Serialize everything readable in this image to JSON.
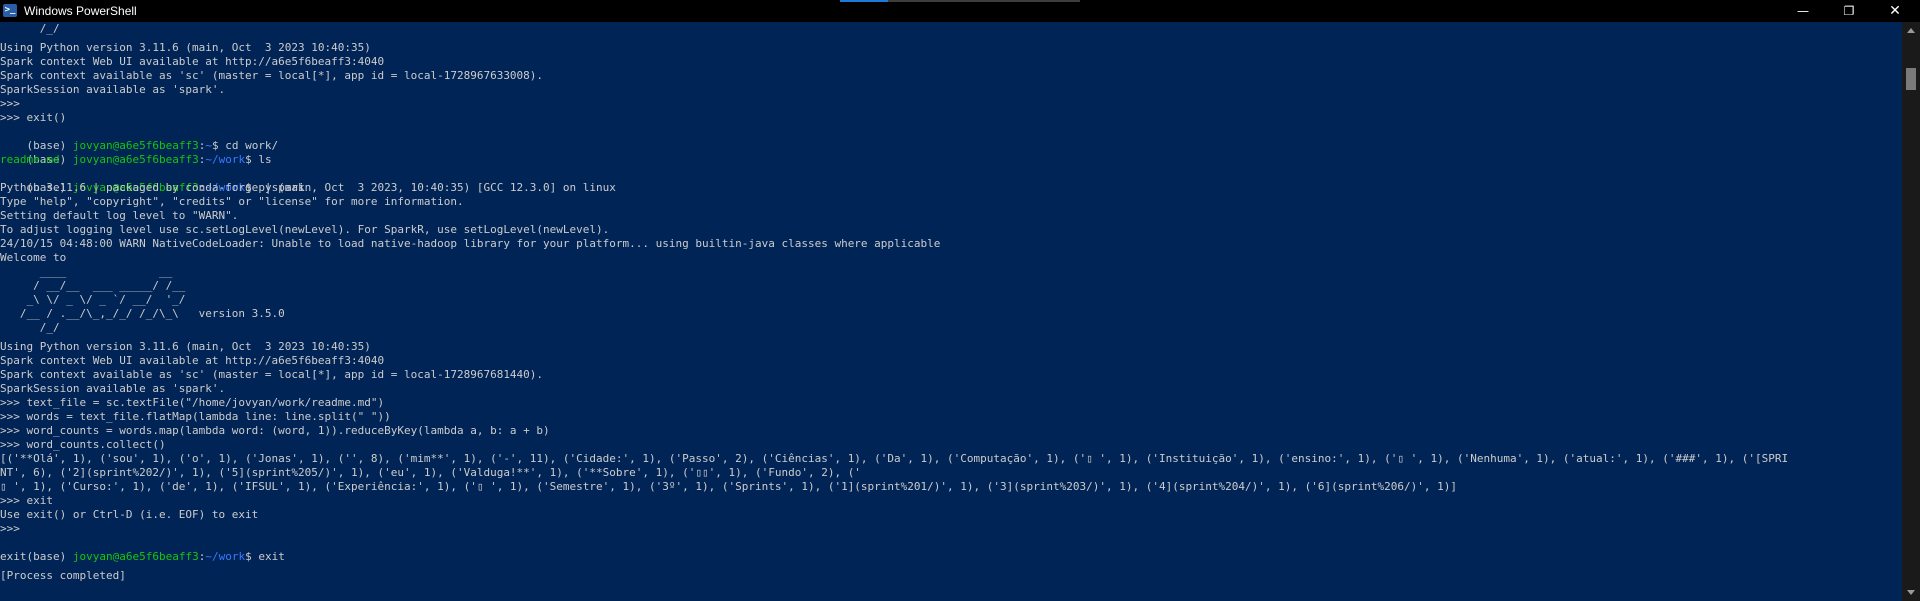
{
  "window": {
    "title": "Windows PowerShell",
    "icon": "powershell-icon",
    "icon_glyph": ">_",
    "minimize_glyph": "—",
    "maximize_glyph": "❐",
    "close_glyph": "✕"
  },
  "colors": {
    "background": "#012456",
    "text": "#cccccc",
    "user_host": "#16c60c",
    "path": "#3b78ff",
    "file": "#16c60c"
  },
  "console": {
    "banner_tail_1": "      /_/",
    "blank_1": "",
    "python_version_1": "Using Python version 3.11.6 (main, Oct  3 2023 10:40:35)",
    "webui_1": "Spark context Web UI available at http://a6e5f6beaff3:4040",
    "context_1": "Spark context available as 'sc' (master = local[*], app id = local-1728967633008).",
    "session_1": "SparkSession available as 'spark'.",
    "prompt_empty_1": ">>>",
    "exit_cmd_1": ">>> exit()",
    "prompt_cd": {
      "prefix": "(base) ",
      "userhost": "jovyan@a6e5f6beaff3",
      "sep": ":",
      "path": "~",
      "cmd": "$ cd work/"
    },
    "prompt_ls": {
      "prefix": "(base) ",
      "userhost": "jovyan@a6e5f6beaff3",
      "sep": ":",
      "path": "~/work",
      "cmd": "$ ls"
    },
    "ls_output": "readme.md",
    "prompt_pyspark": {
      "prefix": "(base) ",
      "userhost": "jovyan@a6e5f6beaff3",
      "sep": ":",
      "path": "~/work",
      "cmd": "$ pyspark"
    },
    "python_header": "Python 3.11.6 | packaged by conda-forge | (main, Oct  3 2023, 10:40:35) [GCC 12.3.0] on linux",
    "type_help": "Type \"help\", \"copyright\", \"credits\" or \"license\" for more information.",
    "log_level": "Setting default log level to \"WARN\".",
    "adjust_logging": "To adjust logging level use sc.setLogLevel(newLevel). For SparkR, use setLogLevel(newLevel).",
    "warn_line": "24/10/15 04:48:00 WARN NativeCodeLoader: Unable to load native-hadoop library for your platform... using builtin-java classes where applicable",
    "welcome": "Welcome to",
    "ascii_1": "      ____              __",
    "ascii_2": "     / __/__  ___ _____/ /__",
    "ascii_3": "    _\\ \\/ _ \\/ _ `/ __/  '_/",
    "ascii_4": "   /__ / .__/\\_,_/_/ /_/\\_\\   version 3.5.0",
    "ascii_5": "      /_/",
    "blank_2": "",
    "python_version_2": "Using Python version 3.11.6 (main, Oct  3 2023 10:40:35)",
    "webui_2": "Spark context Web UI available at http://a6e5f6beaff3:4040",
    "context_2": "Spark context available as 'sc' (master = local[*], app id = local-1728967681440).",
    "session_2": "SparkSession available as 'spark'.",
    "cmd_textfile": ">>> text_file = sc.textFile(\"/home/jovyan/work/readme.md\")",
    "cmd_words": ">>> words = text_file.flatMap(lambda line: line.split(\" \"))",
    "cmd_wordcounts": ">>> word_counts = words.map(lambda word: (word, 1)).reduceByKey(lambda a, b: a + b)",
    "cmd_collect": ">>> word_counts.collect()",
    "result_1": "[('**Olá', 1), ('sou', 1), ('o', 1), ('Jonas', 1), ('', 8), ('mim**', 1), ('-', 11), ('Cidade:', 1), ('Passo', 2), ('Ciências', 1), ('Da', 1), ('Computação', 1), ('▯ ', 1), ('Instituição', 1), ('ensino:', 1), ('▯ ', 1), ('Nenhuma', 1), ('atual:', 1), ('###', 1), ('[SPRI",
    "result_2": "NT', 6), ('2](sprint%202/)', 1), ('5](sprint%205/)', 1), ('eu', 1), ('Valduga!**', 1), ('**Sobre', 1), ('▯▯', 1), ('Fundo', 2), ('",
    "result_3": "▯ ', 1), ('Curso:', 1), ('de', 1), ('IFSUL', 1), ('Experiência:', 1), ('▯ ', 1), ('Semestre', 1), ('3º', 1), ('Sprints', 1), ('1](sprint%201/)', 1), ('3](sprint%203/)', 1), ('4](sprint%204/)', 1), ('6](sprint%206/)', 1)]",
    "cmd_exit": ">>> exit",
    "exit_hint": "Use exit() or Ctrl-D (i.e. EOF) to exit",
    "prompt_empty_2": ">>>",
    "prompt_exit": {
      "prefix": "(base) ",
      "userhost": "jovyan@a6e5f6beaff3",
      "sep": ":",
      "path": "~/work",
      "cmd": "$ exit"
    },
    "exit_echo": "exit",
    "cut_off": "[Process completed]"
  }
}
